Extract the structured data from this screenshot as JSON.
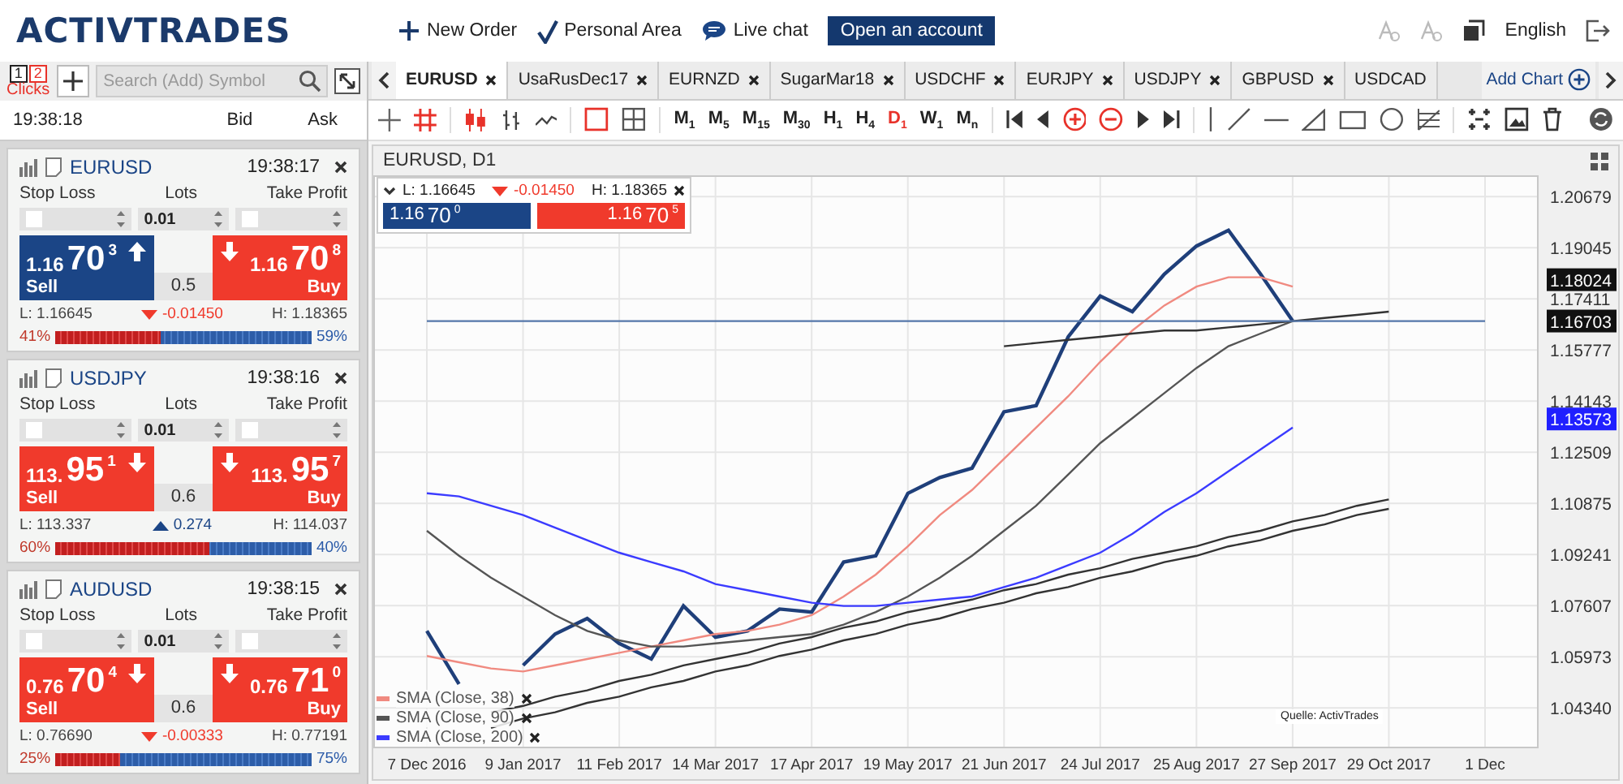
{
  "header": {
    "logo": "ACTIVTRADES",
    "nav": [
      {
        "kind": "new-order",
        "label": "New Order"
      },
      {
        "kind": "personal-area",
        "label": "Personal Area"
      },
      {
        "kind": "live-chat",
        "label": "Live chat"
      }
    ],
    "open_account": "Open an account",
    "language": "English"
  },
  "sidebar": {
    "click_mode": {
      "options": [
        {
          "label": "1",
          "selected": false
        },
        {
          "label": "2",
          "selected": true
        }
      ],
      "label": "Clicks"
    },
    "search": {
      "placeholder": "Search (Add) Symbol"
    },
    "time": "19:38:18",
    "bid_header": "Bid",
    "ask_header": "Ask",
    "widgets": [
      {
        "symbol": "EURUSD",
        "time": "19:38:17",
        "labels": [
          "Stop Loss",
          "Lots",
          "Take Profit"
        ],
        "stop_loss_checked": false,
        "lots": "0.01",
        "take_profit_checked": false,
        "sell": {
          "label": "Sell",
          "big_figure": "1.16",
          "pips": "70",
          "fraction": "3",
          "up": true
        },
        "buy": {
          "label": "Buy",
          "big_figure": "1.16",
          "pips": "70",
          "fraction": "8",
          "up": false
        },
        "volume": "0.5",
        "low": "L: 1.16645",
        "change": "-0.01450",
        "change_up": false,
        "high": "H: 1.18365",
        "sell_pct": "41%",
        "buy_pct": "59%",
        "level": 0.41
      },
      {
        "symbol": "USDJPY",
        "time": "19:38:16",
        "labels": [
          "Stop Loss",
          "Lots",
          "Take Profit"
        ],
        "stop_loss_checked": false,
        "lots": "0.01",
        "take_profit_checked": false,
        "sell": {
          "label": "Sell",
          "big_figure": "113.",
          "pips": "95",
          "fraction": "1",
          "up": false
        },
        "buy": {
          "label": "Buy",
          "big_figure": "113.",
          "pips": "95",
          "fraction": "7",
          "up": false
        },
        "volume": "0.6",
        "low": "L: 113.337",
        "change": "0.274",
        "change_up": true,
        "high": "H: 114.037",
        "sell_pct": "60%",
        "buy_pct": "40%",
        "level": 0.6
      },
      {
        "symbol": "AUDUSD",
        "time": "19:38:15",
        "labels": [
          "Stop Loss",
          "Lots",
          "Take Profit"
        ],
        "stop_loss_checked": false,
        "lots": "0.01",
        "take_profit_checked": false,
        "sell": {
          "label": "Sell",
          "big_figure": "0.76",
          "pips": "70",
          "fraction": "4",
          "up": false
        },
        "buy": {
          "label": "Buy",
          "big_figure": "0.76",
          "pips": "71",
          "fraction": "0",
          "up": false
        },
        "volume": "0.6",
        "low": "L: 0.76690",
        "change": "-0.00333",
        "change_up": false,
        "high": "H: 0.77191",
        "sell_pct": "25%",
        "buy_pct": "75%",
        "level": 0.25
      }
    ]
  },
  "tabs": [
    {
      "label": "EURUSD",
      "selected": true,
      "closable": true
    },
    {
      "label": "UsaRusDec17",
      "selected": false,
      "closable": true
    },
    {
      "label": "EURNZD",
      "selected": false,
      "closable": true
    },
    {
      "label": "SugarMar18",
      "selected": false,
      "closable": true
    },
    {
      "label": "USDCHF",
      "selected": false,
      "closable": true
    },
    {
      "label": "EURJPY",
      "selected": false,
      "closable": true
    },
    {
      "label": "USDJPY",
      "selected": false,
      "closable": true
    },
    {
      "label": "GBPUSD",
      "selected": false,
      "closable": true
    },
    {
      "label": "USDCAD",
      "selected": false,
      "closable": false
    }
  ],
  "add_chart": "Add Chart",
  "toolbar": {
    "timeframes": [
      {
        "label": "M$_{1}$",
        "selected": false
      },
      {
        "label": "M$_{5}$",
        "selected": false
      },
      {
        "label": "M$_{15}$",
        "selected": false
      },
      {
        "label": "M$_{30}$",
        "selected": false
      },
      {
        "label": "H$_{1}$",
        "selected": false
      },
      {
        "label": "H$_{4}$",
        "selected": false
      },
      {
        "label": "D$_{1}$",
        "selected": true
      },
      {
        "label": "W$_{1}$",
        "selected": false
      },
      {
        "label": "M$_{n}$",
        "selected": false
      }
    ]
  },
  "chart": {
    "title": "EURUSD, D1",
    "quote": {
      "low": "L: 1.16645",
      "change": "-0.01450",
      "change_up": false,
      "high": "H: 1.18365",
      "sell": {
        "big_figure": "1.16",
        "pips": "70",
        "fraction": "0"
      },
      "buy": {
        "big_figure": "1.16",
        "pips": "70",
        "fraction": "5"
      }
    },
    "price_tags": [
      {
        "label": "1.18024",
        "color": "#111111"
      },
      {
        "label": "1.16703",
        "color": "#111111"
      },
      {
        "label": "1.13573",
        "color": "#2020ff"
      }
    ],
    "source": "Quelle: ActivTrades",
    "chart_data": {
      "type": "line",
      "grid": true,
      "legend": "lower left",
      "categories": [
        "7 Dec 2016",
        null,
        null,
        "9 Jan 2017",
        null,
        null,
        "11 Feb 2017",
        null,
        null,
        "14 Mar 2017",
        null,
        null,
        "17 Apr 2017",
        null,
        null,
        "19 May 2017",
        null,
        null,
        "21 Jun 2017",
        null,
        null,
        "24 Jul 2017",
        null,
        null,
        "25 Aug 2017",
        null,
        null,
        "27 Sep 2017",
        null,
        null,
        "29 Oct 2017",
        null,
        null,
        "1 Dec"
      ],
      "series": [
        {
          "color": "#1f3f7a",
          "values": [
            1.068,
            1.051,
            null,
            1.057,
            1.067,
            1.072,
            1.064,
            1.059,
            1.076,
            1.066,
            1.068,
            1.075,
            1.074,
            1.09,
            1.092,
            1.112,
            1.117,
            1.12,
            1.138,
            1.14,
            1.162,
            1.175,
            1.17,
            1.182,
            1.191,
            1.196,
            1.182,
            1.167,
            null,
            null,
            null,
            null,
            null,
            null
          ]
        },
        {
          "name": "SMA (Close, 38)",
          "color": "#f08a80",
          "values": [
            1.06,
            1.058,
            1.056,
            1.055,
            1.057,
            1.059,
            1.061,
            1.063,
            1.065,
            1.067,
            1.068,
            1.07,
            1.073,
            1.079,
            1.086,
            1.095,
            1.105,
            1.113,
            1.123,
            1.133,
            1.143,
            1.154,
            1.164,
            1.172,
            1.178,
            1.181,
            1.181,
            1.178,
            null,
            null,
            null,
            null,
            null,
            null
          ]
        },
        {
          "name": "SMA (Close, 90)",
          "color": "#555555",
          "values": [
            1.1,
            1.092,
            1.085,
            1.079,
            1.073,
            1.068,
            1.065,
            1.063,
            1.063,
            1.064,
            1.065,
            1.066,
            1.067,
            1.07,
            1.074,
            1.079,
            1.085,
            1.092,
            1.1,
            1.108,
            1.118,
            1.128,
            1.136,
            1.144,
            1.152,
            1.159,
            1.163,
            1.167,
            null,
            null,
            null,
            null,
            null,
            null
          ]
        },
        {
          "name": "SMA (Close, 200)",
          "color": "#3b3bff",
          "values": [
            1.112,
            1.111,
            1.108,
            1.105,
            1.101,
            1.097,
            1.093,
            1.09,
            1.087,
            1.083,
            1.081,
            1.079,
            1.077,
            1.076,
            1.076,
            1.077,
            1.078,
            1.079,
            1.082,
            1.085,
            1.089,
            1.093,
            1.099,
            1.106,
            1.112,
            1.119,
            1.126,
            1.133,
            null,
            null,
            null,
            null,
            null,
            null
          ]
        },
        {
          "color": "#333333",
          "values": [
            null,
            null,
            1.042,
            1.044,
            1.047,
            1.049,
            1.052,
            1.054,
            1.057,
            1.059,
            1.061,
            1.064,
            1.066,
            1.069,
            1.071,
            1.074,
            1.076,
            1.078,
            1.081,
            1.083,
            1.086,
            1.088,
            1.091,
            1.093,
            1.095,
            1.098,
            1.1,
            1.103,
            1.105,
            1.108,
            1.11,
            null,
            null,
            null
          ]
        },
        {
          "color": "#333333",
          "values": [
            null,
            null,
            1.037,
            1.04,
            1.042,
            1.045,
            1.047,
            1.05,
            1.052,
            1.055,
            1.057,
            1.06,
            1.062,
            1.065,
            1.067,
            1.07,
            1.072,
            1.075,
            1.077,
            1.08,
            1.082,
            1.085,
            1.087,
            1.09,
            1.092,
            1.095,
            1.097,
            1.1,
            1.102,
            1.105,
            1.107,
            null,
            null,
            null
          ]
        },
        {
          "color": "#333333",
          "values": [
            null,
            null,
            null,
            null,
            null,
            null,
            null,
            null,
            null,
            null,
            null,
            null,
            null,
            null,
            null,
            null,
            null,
            null,
            1.159,
            1.16,
            1.161,
            1.162,
            1.163,
            1.164,
            1.164,
            1.165,
            1.166,
            1.167,
            1.168,
            1.169,
            1.17,
            null,
            null,
            null
          ]
        },
        {
          "color": "#5577aa",
          "values": [
            1.167,
            1.167,
            1.167,
            1.167,
            1.167,
            1.167,
            1.167,
            1.167,
            1.167,
            1.167,
            1.167,
            1.167,
            1.167,
            1.167,
            1.167,
            1.167,
            1.167,
            1.167,
            1.167,
            1.167,
            1.167,
            1.167,
            1.167,
            1.167,
            1.167,
            1.167,
            1.167,
            1.167,
            1.167,
            1.167,
            1.167,
            1.167,
            1.167,
            1.167
          ]
        }
      ],
      "ylim": [
        1.031,
        1.2136
      ],
      "yticks": [
        {
          "value": 1.0434,
          "label": "1.04340"
        },
        {
          "value": 1.05973,
          "label": "1.05973"
        },
        {
          "value": 1.07607,
          "label": "1.07607"
        },
        {
          "value": 1.09241,
          "label": "1.09241"
        },
        {
          "value": 1.10875,
          "label": "1.10875"
        },
        {
          "value": 1.12509,
          "label": "1.12509"
        },
        {
          "value": 1.14143,
          "label": "1.14143"
        },
        {
          "value": 1.15777,
          "label": "1.15777"
        },
        {
          "value": 1.17411,
          "label": "1.17411"
        },
        {
          "value": 1.19045,
          "label": "1.19045"
        },
        {
          "value": 1.20679,
          "label": "1.20679"
        }
      ]
    }
  }
}
